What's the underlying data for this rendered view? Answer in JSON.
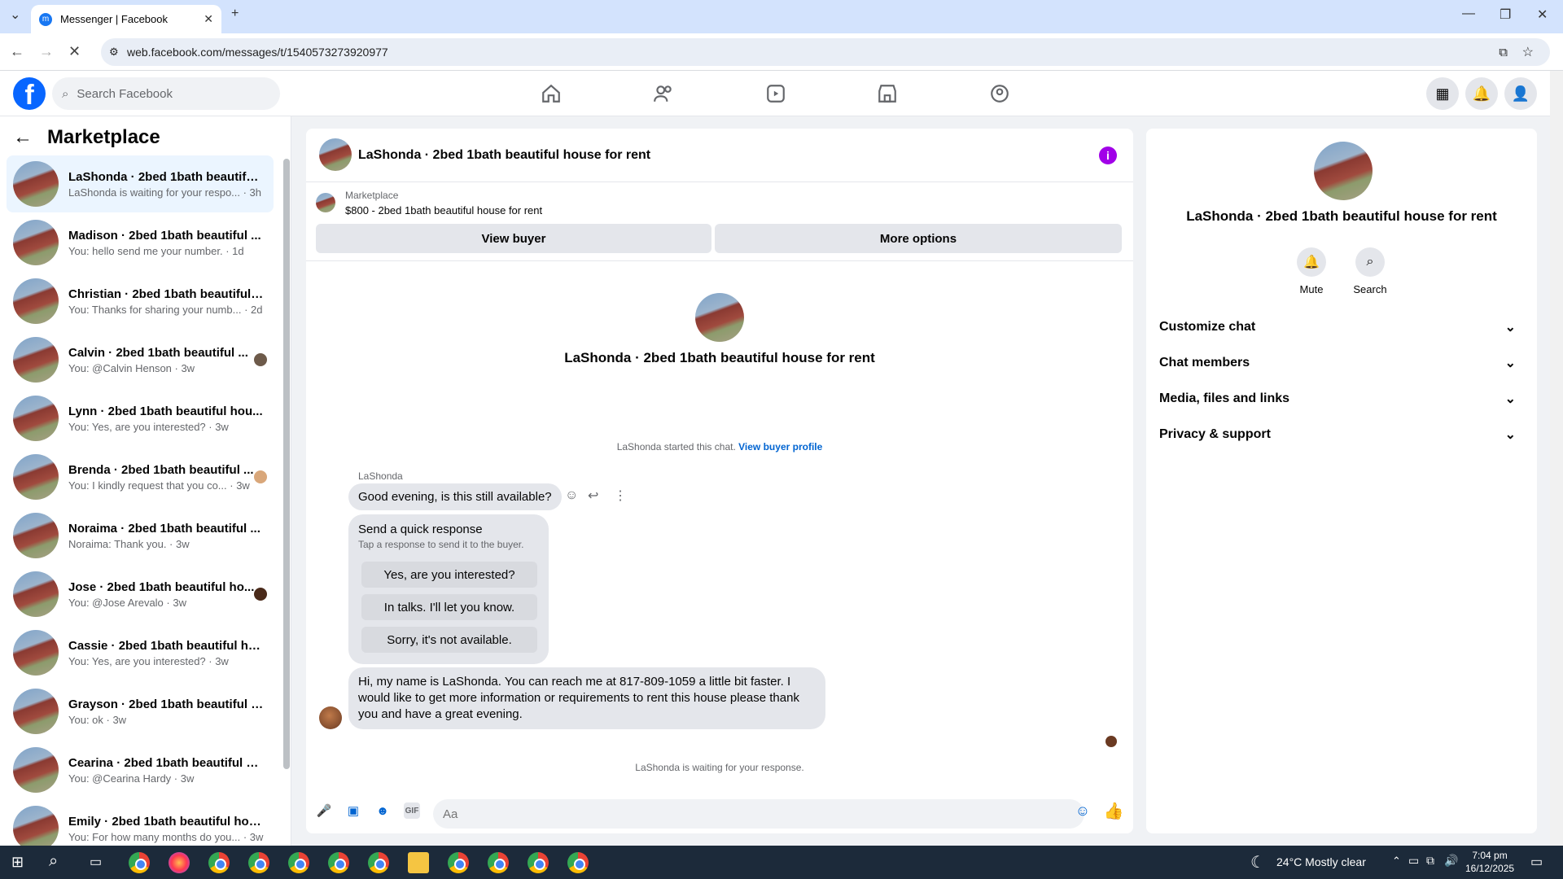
{
  "browser": {
    "tab_title": "Messenger | Facebook",
    "url": "web.facebook.com/messages/t/1540573273920977"
  },
  "fb": {
    "search_placeholder": "Search Facebook"
  },
  "left": {
    "title": "Marketplace",
    "conversations": [
      {
        "name": "LaShonda · 2bed 1bath beautiful...",
        "preview": "LaShonda is waiting for your respo... · 3h"
      },
      {
        "name": "Madison · 2bed 1bath beautiful ...",
        "preview": "You: hello send me your number. · 1d"
      },
      {
        "name": "Christian · 2bed 1bath beautiful ...",
        "preview": "You: Thanks for sharing your numb... · 2d"
      },
      {
        "name": "Calvin · 2bed 1bath beautiful ...",
        "preview": "You: @Calvin Henson · 3w"
      },
      {
        "name": "Lynn · 2bed 1bath beautiful hou...",
        "preview": "You: Yes, are you interested? · 3w"
      },
      {
        "name": "Brenda · 2bed 1bath beautiful ...",
        "preview": "You: I kindly request that you co... · 3w"
      },
      {
        "name": "Noraima · 2bed 1bath beautiful ...",
        "preview": "Noraima: Thank you. · 3w"
      },
      {
        "name": "Jose · 2bed 1bath beautiful ho...",
        "preview": "You: @Jose Arevalo · 3w"
      },
      {
        "name": "Cassie · 2bed 1bath beautiful ho...",
        "preview": "You: Yes, are you interested? · 3w"
      },
      {
        "name": "Grayson · 2bed 1bath beautiful h...",
        "preview": "You: ok · 3w"
      },
      {
        "name": "Cearina · 2bed 1bath beautiful h...",
        "preview": "You: @Cearina Hardy · 3w"
      },
      {
        "name": "Emily · 2bed 1bath beautiful hou...",
        "preview": "You: For how many months do you... · 3w"
      }
    ]
  },
  "chat": {
    "title": "LaShonda · 2bed 1bath beautiful house for rent",
    "marketplace_label": "Marketplace",
    "listing": "$800 - 2bed 1bath beautiful house for rent",
    "view_buyer": "View buyer",
    "more_options": "More options",
    "center_name": "LaShonda · 2bed 1bath beautiful house for rent",
    "started_text": "LaShonda started this chat.",
    "view_profile": "View buyer profile",
    "sender": "LaShonda",
    "msg1": "Good evening, is this still available?",
    "quick_title": "Send a quick response",
    "quick_sub": "Tap a response to send it to the buyer.",
    "quick_responses": [
      "Yes, are you interested?",
      "In talks. I'll let you know.",
      "Sorry, it's not available."
    ],
    "msg2": "Hi, my name is LaShonda. You can reach me at 817-809-1059 a little bit faster. I would like to get more information or requirements to rent this house please thank you and have a great evening.",
    "waiting": "LaShonda is waiting for your response.",
    "input_placeholder": "Aa"
  },
  "right": {
    "name": "LaShonda · 2bed 1bath beautiful house for rent",
    "mute": "Mute",
    "search": "Search",
    "rows": [
      "Customize chat",
      "Chat members",
      "Media, files and links",
      "Privacy & support"
    ]
  },
  "taskbar": {
    "weather": "24°C  Mostly clear",
    "time": "7:04 pm",
    "date": "16/12/2025"
  }
}
